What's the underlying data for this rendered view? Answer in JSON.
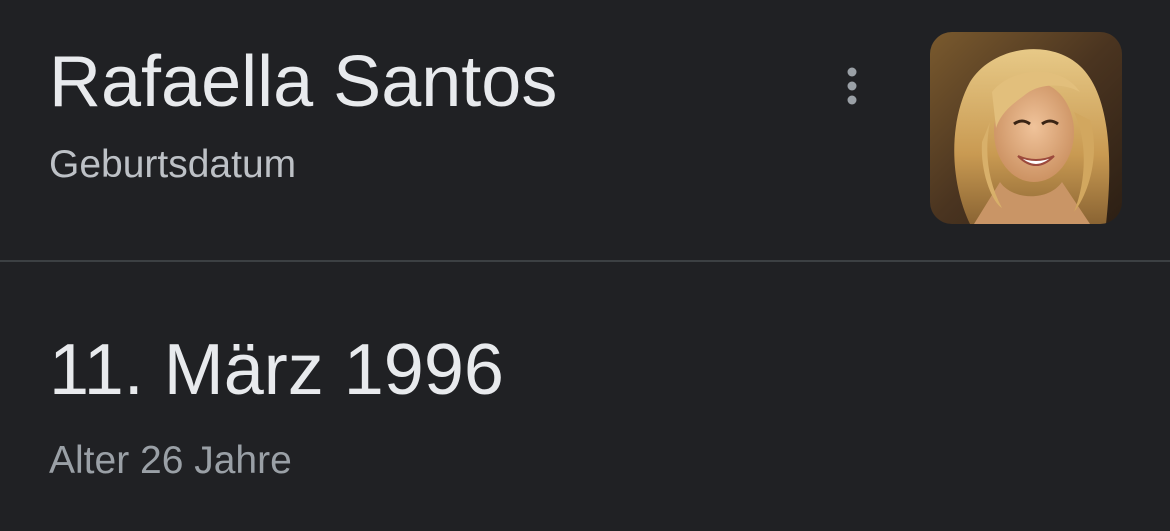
{
  "header": {
    "name": "Rafaella Santos",
    "subtitle": "Geburtsdatum",
    "menu_icon": "more-vert-icon",
    "thumbnail_alt": "Rafaella Santos"
  },
  "answer": {
    "date": "11. März 1996",
    "age": "Alter 26 Jahre"
  },
  "colors": {
    "background": "#202124",
    "primary_text": "#e8eaed",
    "secondary_text": "#bdc1c6",
    "tertiary_text": "#9aa0a6",
    "divider": "#3c4043"
  }
}
